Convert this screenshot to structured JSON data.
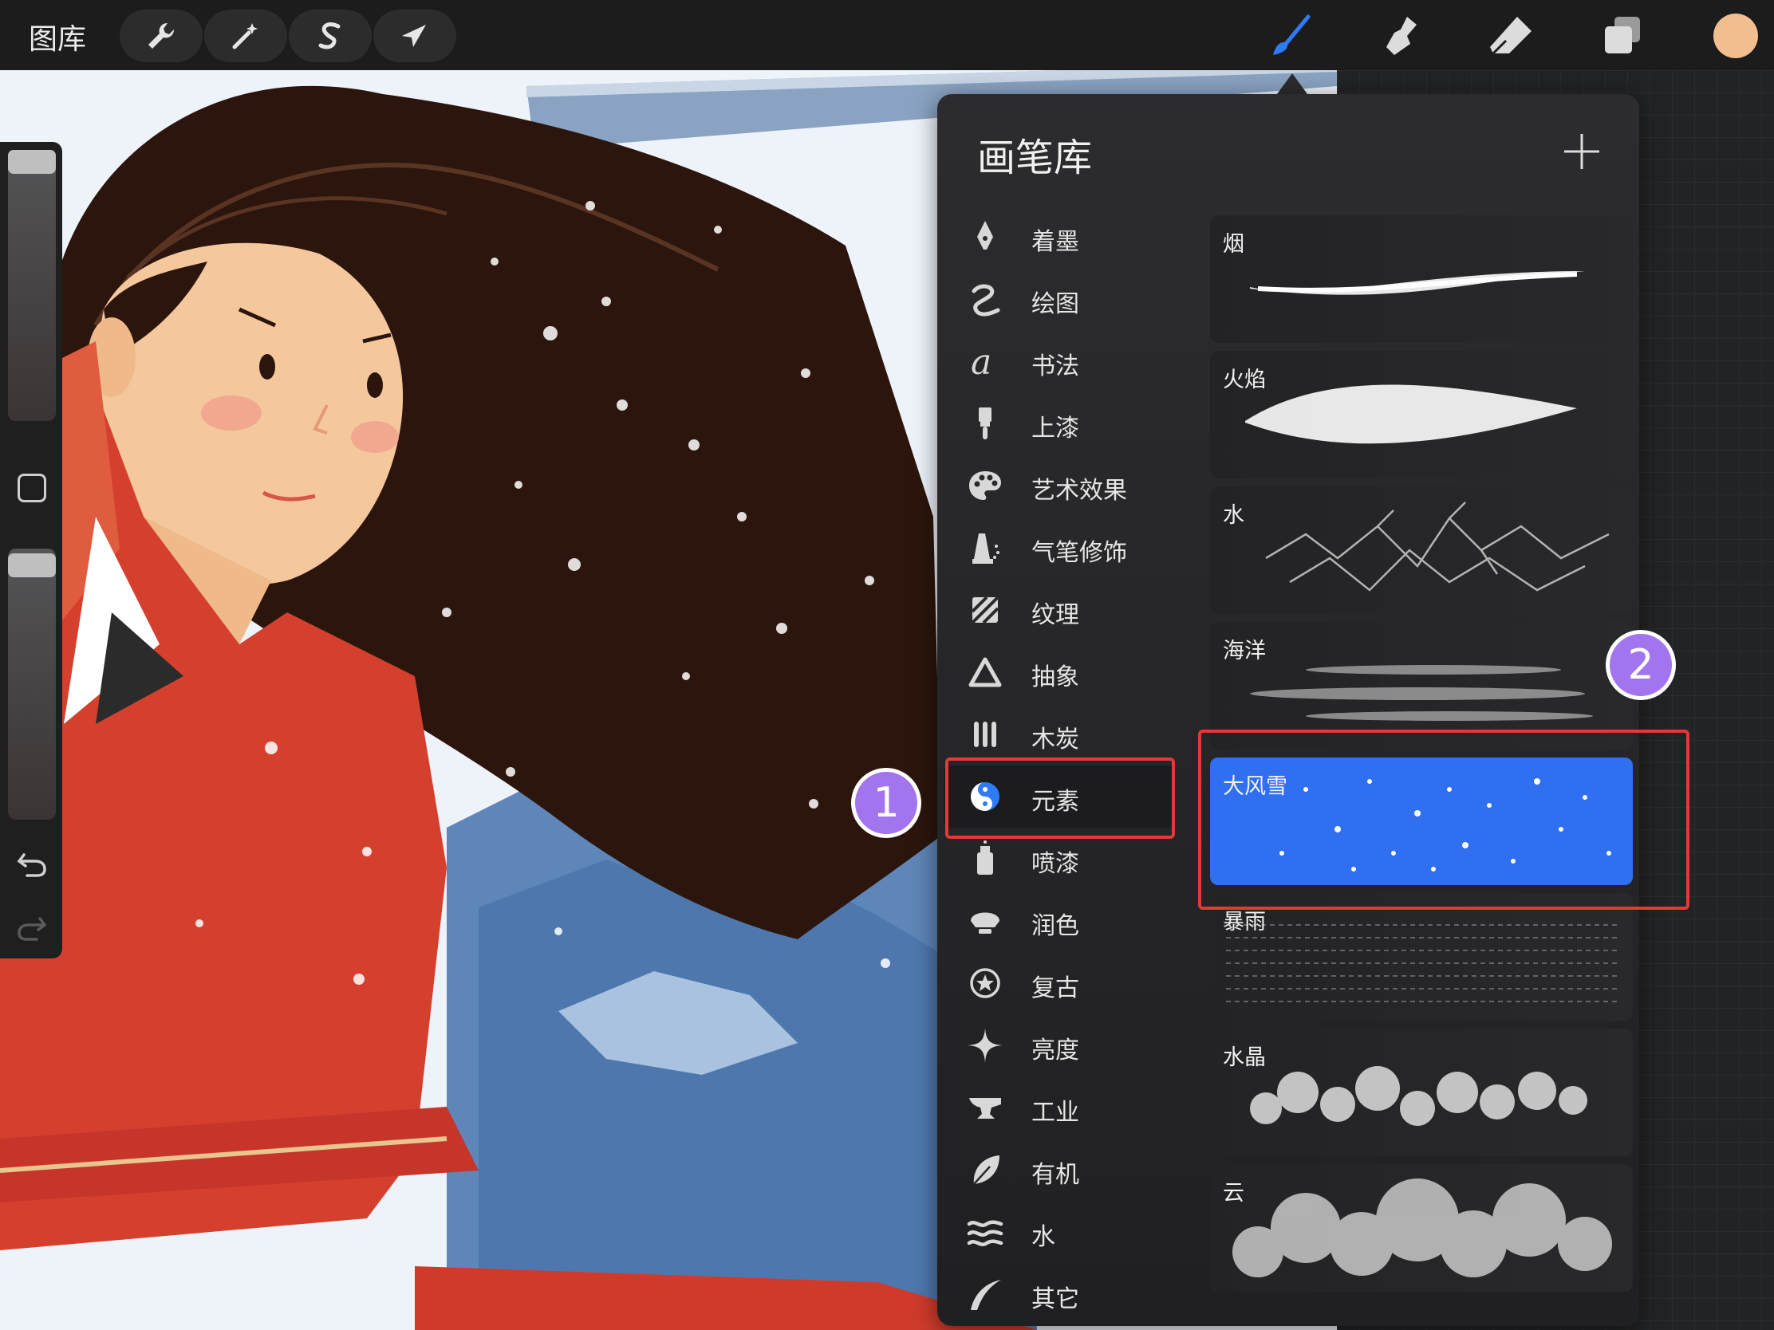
{
  "toolbar": {
    "gallery_label": "图库",
    "left_tools": [
      {
        "name": "actions-wrench-icon"
      },
      {
        "name": "adjustments-magic-wand-icon"
      },
      {
        "name": "selection-s-icon"
      },
      {
        "name": "transform-arrow-icon"
      }
    ],
    "right_tools": [
      {
        "name": "brush-icon",
        "active": true,
        "color": "#2f7bf5"
      },
      {
        "name": "smudge-icon"
      },
      {
        "name": "eraser-icon"
      },
      {
        "name": "layers-icon"
      }
    ],
    "current_color": "#f2be8f"
  },
  "brush_library": {
    "title": "画笔库",
    "add_icon": "plus-icon",
    "categories": [
      {
        "label": "着墨",
        "icon": "ink-pen-icon"
      },
      {
        "label": "绘图",
        "icon": "sketch-squiggle-icon"
      },
      {
        "label": "书法",
        "icon": "calligraphy-a-icon"
      },
      {
        "label": "上漆",
        "icon": "paint-roller-icon"
      },
      {
        "label": "艺术效果",
        "icon": "palette-icon"
      },
      {
        "label": "气笔修饰",
        "icon": "airbrush-icon"
      },
      {
        "label": "纹理",
        "icon": "texture-stripes-icon"
      },
      {
        "label": "抽象",
        "icon": "triangle-icon"
      },
      {
        "label": "木炭",
        "icon": "charcoal-bars-icon"
      },
      {
        "label": "元素",
        "icon": "yin-yang-icon",
        "active": true
      },
      {
        "label": "喷漆",
        "icon": "spray-can-icon"
      },
      {
        "label": "润色",
        "icon": "blend-shell-icon"
      },
      {
        "label": "复古",
        "icon": "star-circle-icon"
      },
      {
        "label": "亮度",
        "icon": "sparkle-icon"
      },
      {
        "label": "工业",
        "icon": "anvil-icon"
      },
      {
        "label": "有机",
        "icon": "leaf-icon"
      },
      {
        "label": "水",
        "icon": "waves-icon"
      },
      {
        "label": "其它",
        "icon": "swoosh-icon"
      }
    ],
    "brushes": [
      {
        "name": "烟"
      },
      {
        "name": "火焰"
      },
      {
        "name": "水"
      },
      {
        "name": "海洋"
      },
      {
        "name": "大风雪",
        "selected": true
      },
      {
        "name": "暴雨"
      },
      {
        "name": "水晶"
      },
      {
        "name": "云"
      }
    ]
  },
  "annotations": [
    {
      "label": "1"
    },
    {
      "label": "2"
    }
  ],
  "colors": {
    "accent": "#2f6ff0",
    "badge": "#a274ee",
    "highlight": "#e33a36"
  }
}
